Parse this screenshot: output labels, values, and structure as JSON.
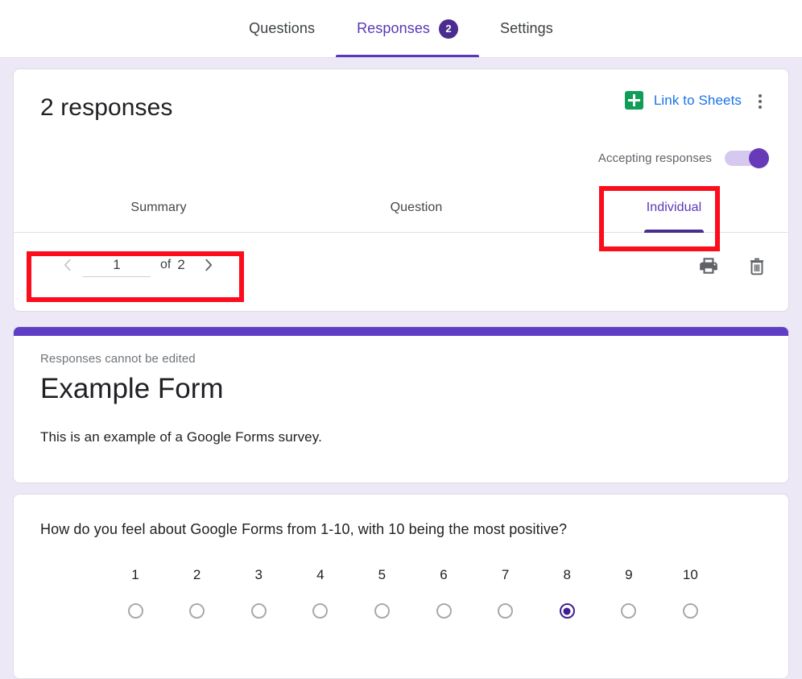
{
  "top_tabs": [
    {
      "label": "Questions",
      "active": false,
      "badge": null
    },
    {
      "label": "Responses",
      "active": true,
      "badge": "2"
    },
    {
      "label": "Settings",
      "active": false,
      "badge": null
    }
  ],
  "responses_panel": {
    "count_label": "2 responses",
    "link_to_sheets_label": "Link to Sheets",
    "sheets_icon": "google-sheets-icon",
    "more_options_icon": "kebab-menu-icon",
    "accepting_responses_label": "Accepting responses",
    "accepting_responses_on": true,
    "sub_tabs": [
      {
        "label": "Summary",
        "active": false
      },
      {
        "label": "Question",
        "active": false
      },
      {
        "label": "Individual",
        "active": true
      }
    ],
    "pagination": {
      "prev_icon": "chevron-left-icon",
      "next_icon": "chevron-right-icon",
      "current_page": "1",
      "of_label": "of",
      "total_pages": "2"
    },
    "actions": {
      "print_icon": "print-icon",
      "delete_icon": "trash-icon"
    }
  },
  "form_header": {
    "edit_note": "Responses cannot be edited",
    "title": "Example Form",
    "description": "This is an example of a Google Forms survey."
  },
  "question": {
    "text": "How do you feel about Google Forms from 1-10, with 10 being the most positive?",
    "scale_labels": [
      "1",
      "2",
      "3",
      "4",
      "5",
      "6",
      "7",
      "8",
      "9",
      "10"
    ],
    "selected_value": "8"
  },
  "annotations": [
    {
      "name": "individual-tab-highlight",
      "color": "#fc0d1b"
    },
    {
      "name": "pagination-highlight",
      "color": "#fc0d1b"
    }
  ],
  "colors": {
    "page_background": "#ece8f6",
    "brand_purple": "#5b37b7",
    "form_stripe_purple": "#5f3dc4",
    "badge_purple": "#4b2d8f",
    "link_blue": "#1a73e8",
    "sheets_green": "#0f9d58",
    "annotation_red": "#fc0d1b"
  }
}
